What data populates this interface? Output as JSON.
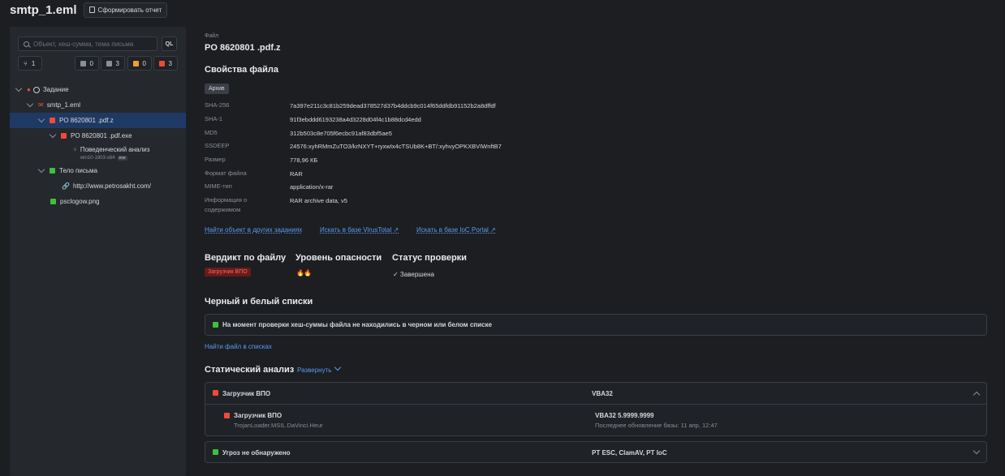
{
  "header": {
    "title": "smtp_1.eml",
    "report_button": "Сформировать отчет"
  },
  "sidebar": {
    "search_placeholder": "Объект, хеш-сумма, тема письма",
    "ql_label": "QL",
    "filters": [
      {
        "name": "tree",
        "count": "1"
      },
      {
        "name": "gray",
        "count": "0",
        "color": "#8a8e96"
      },
      {
        "name": "doc",
        "count": "3",
        "color": "#8a8e96"
      },
      {
        "name": "orange",
        "count": "0",
        "color": "#f0a030"
      },
      {
        "name": "red",
        "count": "3",
        "color": "#f04a3a"
      }
    ],
    "tree": [
      {
        "label": "Задание"
      },
      {
        "label": "smtp_1.eml"
      },
      {
        "label": "PO 8620801 .pdf.z"
      },
      {
        "label": "PO 8620801 .pdf.exe"
      },
      {
        "label": "Поведенческий анализ",
        "sub": "win10-1803-x64",
        "tag": "exe"
      },
      {
        "label": "Тело письма"
      },
      {
        "label": "http://www.petrosakht.com/"
      },
      {
        "label": "psclogow.png"
      }
    ]
  },
  "main": {
    "file_label": "Файл",
    "file_name": "PO 8620801 .pdf.z",
    "props_title": "Свойства файла",
    "archive_badge": "Архив",
    "props": [
      {
        "k": "SHA-256",
        "v": "7a397e211c3c81b259dead378527d37b4ddcb9c014f65ddfdb91152b2a8dffdf"
      },
      {
        "k": "SHA-1",
        "v": "91f3ebddd6193238a4d3228d04f4c1b88dcd4edd"
      },
      {
        "k": "MD5",
        "v": "312b503c8e705f6ecbc91af83dbf5ae5"
      },
      {
        "k": "SSDEEP",
        "v": "24576:xyhRMmZuTO3/krNXYT+ryxwIx4cTSUb8K+BT/:xyhvyOPKXBVIWnftB7"
      },
      {
        "k": "Размер",
        "v": "778,96 КБ"
      },
      {
        "k": "Формат файла",
        "v": "RAR"
      },
      {
        "k": "MIME-тип",
        "v": "application/x-rar"
      },
      {
        "k": "Информация о содержимом",
        "v": "RAR archive data, v5"
      }
    ],
    "links": [
      "Найти объект в других заданиях",
      "Искать в базе VirusTotal ↗",
      "Искать в базе IoC Portal ↗"
    ],
    "verdict_title": "Вердикт по файлу",
    "verdict_value": "Загрузчик ВПО",
    "danger_title": "Уровень опасности",
    "danger_value": "🔥🔥",
    "status_title": "Статус проверки",
    "status_value": "✓ Завершена",
    "lists_title": "Черный и белый списки",
    "lists_text": "На момент проверки хеш-суммы файла не находились в черном или белом списке",
    "lists_link": "Найти файл в списках",
    "static_title": "Статический анализ",
    "static_expand": "Развернуть",
    "static_rows": [
      {
        "verdict": "Загрузчик ВПО",
        "engine": "VBA32"
      },
      {
        "verdict": "Загрузчик ВПО",
        "detail": "TrojanLoader.MSIL.DaVinci.Heur",
        "engine": "VBA32 5.9999.9999",
        "updated": "Последнее обновление базы: 11 апр, 12:47"
      },
      {
        "verdict": "Угроз не обнаружено",
        "engine": "PT ESC, ClamAV, PT IoC"
      }
    ]
  },
  "colors": {
    "red": "#f04a3a",
    "green": "#3fbf3f",
    "link": "#5b9bf0",
    "selected": "#1e3a64"
  }
}
